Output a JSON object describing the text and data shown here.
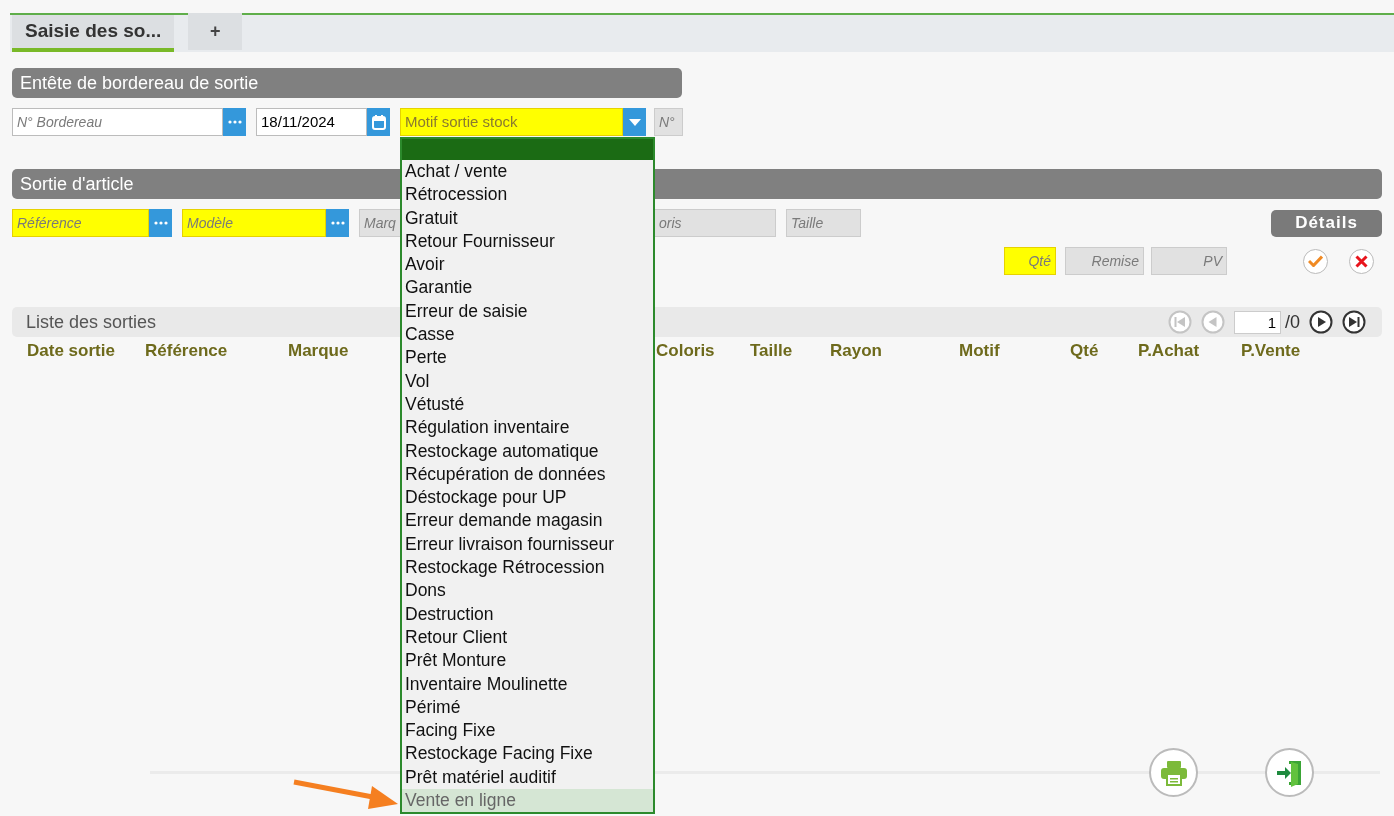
{
  "tabs": [
    {
      "label": "Saisie des so...",
      "selected": true
    },
    {
      "label": "+",
      "selected": false
    }
  ],
  "header_section": {
    "title": "Entête de bordereau de sortie",
    "fields": [
      {
        "kind": "lookup",
        "placeholder": "N° Bordereau",
        "required": false,
        "disabled": false
      },
      {
        "kind": "date",
        "value": "18/11/2024",
        "required": false,
        "disabled": false
      },
      {
        "kind": "select",
        "placeholder": "Motif sortie stock",
        "required": true,
        "disabled": false,
        "expanded": true
      },
      {
        "kind": "plain",
        "placeholder": "N°",
        "required": false,
        "disabled": true
      }
    ]
  },
  "article_section": {
    "title": "Sortie d'article",
    "fields": [
      {
        "kind": "lookup",
        "placeholder": "Référence",
        "required": true,
        "disabled": false
      },
      {
        "kind": "lookup",
        "placeholder": "Modèle",
        "required": true,
        "disabled": false
      },
      {
        "kind": "plain",
        "placeholder": "Marq",
        "required": false,
        "disabled": true
      },
      {
        "kind": "plain",
        "placeholder": "oris",
        "required": false,
        "disabled": true
      },
      {
        "kind": "plain",
        "placeholder": "Taille",
        "required": false,
        "disabled": true
      }
    ],
    "details_button": "Détails",
    "amount_fields": [
      {
        "placeholder": "Qté",
        "required": true,
        "disabled": false
      },
      {
        "placeholder": "Remise",
        "required": false,
        "disabled": true
      },
      {
        "placeholder": "PV",
        "required": false,
        "disabled": true
      }
    ]
  },
  "list": {
    "title": "Liste des sorties",
    "pager": {
      "buttons": [
        {
          "kind": "first",
          "disabled": true
        },
        {
          "kind": "prev",
          "disabled": true
        },
        {
          "kind": "next",
          "disabled": false
        },
        {
          "kind": "last",
          "disabled": false
        }
      ],
      "page": "1",
      "total": "/0"
    },
    "columns": [
      "Date sortie",
      "Référence",
      "Marque",
      "Coloris",
      "Taille",
      "Rayon",
      "Motif",
      "Qté",
      "P.Achat",
      "P.Vente"
    ]
  },
  "motif_dropdown": {
    "options": [
      {
        "label": "Achat / vente",
        "selected": false
      },
      {
        "label": "Rétrocession",
        "selected": false
      },
      {
        "label": "Gratuit",
        "selected": false
      },
      {
        "label": "Retour Fournisseur",
        "selected": false
      },
      {
        "label": "Avoir",
        "selected": false
      },
      {
        "label": "Garantie",
        "selected": false
      },
      {
        "label": "Erreur de saisie",
        "selected": false
      },
      {
        "label": "Casse",
        "selected": false
      },
      {
        "label": "Perte",
        "selected": false
      },
      {
        "label": "Vol",
        "selected": false
      },
      {
        "label": "Vétusté",
        "selected": false
      },
      {
        "label": "Régulation inventaire",
        "selected": false
      },
      {
        "label": "Restockage automatique",
        "selected": false
      },
      {
        "label": "Récupération de données",
        "selected": false
      },
      {
        "label": "Déstockage pour UP",
        "selected": false
      },
      {
        "label": "Erreur demande magasin",
        "selected": false
      },
      {
        "label": "Erreur livraison fournisseur",
        "selected": false
      },
      {
        "label": "Restockage Rétrocession",
        "selected": false
      },
      {
        "label": "Dons",
        "selected": false
      },
      {
        "label": "Destruction",
        "selected": false
      },
      {
        "label": "Retour Client",
        "selected": false
      },
      {
        "label": "Prêt Monture",
        "selected": false
      },
      {
        "label": "Inventaire Moulinette",
        "selected": false
      },
      {
        "label": "Périmé",
        "selected": false
      },
      {
        "label": "Facing Fixe",
        "selected": false
      },
      {
        "label": "Restockage Facing Fixe",
        "selected": false
      },
      {
        "label": "Prêt matériel auditif",
        "selected": false
      },
      {
        "label": "Vente en ligne",
        "selected": true
      }
    ]
  }
}
